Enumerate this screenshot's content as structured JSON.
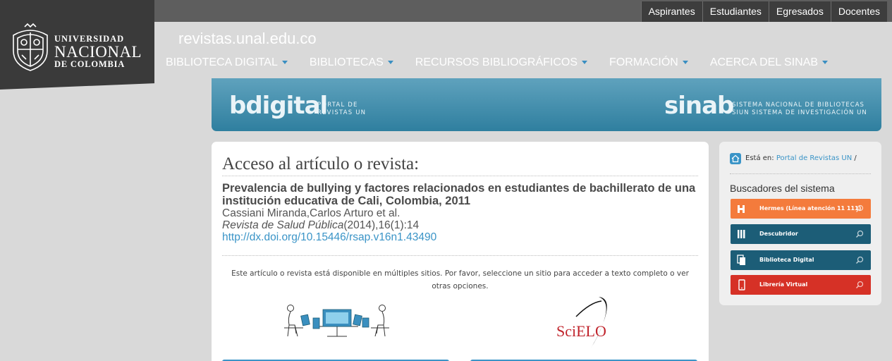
{
  "top_links": [
    "Aspirantes",
    "Estudiantes",
    "Egresados",
    "Docentes"
  ],
  "logo": {
    "line1": "UNIVERSIDAD",
    "line2": "NACIONAL",
    "line3": "DE COLOMBIA"
  },
  "site_url": "revistas.unal.edu.co",
  "nav": [
    "BIBLIOTECA DIGITAL",
    "BIBLIOTECAS",
    "RECURSOS BIBLIOGRÁFICOS",
    "FORMACIÓN",
    "ACERCA DEL SINAB"
  ],
  "banner": {
    "left_logo": "bdigital",
    "left_sub1": "PORTAL DE",
    "left_sub2": "REVISTAS UN",
    "right_logo": "sinab",
    "right_sub1": "SISTEMA NACIONAL DE BIBLIOTECAS",
    "right_sub2": "SIUN SISTEMA DE INVESTIGACIÓN UN"
  },
  "main": {
    "heading": "Acceso al artículo o revista:",
    "article_title": "Prevalencia de bullying y factores relacionados en estudiantes de bachillerato de una institución educativa de Cali, Colombia, 2011",
    "authors": "Cassiani Miranda,Carlos Arturo et al.",
    "journal": "Revista de Salud Pública",
    "citation": "(2014),16(1):14",
    "doi": "http://dx.doi.org/10.15446/rsap.v16n1.43490",
    "notice": "Este artículo o revista está disponible en múltiples sitios. Por favor, seleccione un sitio para acceder a texto completo o ver otras opciones.",
    "scielo_logo": "SciELO"
  },
  "sidebar": {
    "breadcrumb_prefix": "Está en:",
    "breadcrumb_link": "Portal de Revistas UN",
    "breadcrumb_sep": "/",
    "heading": "Buscadores del sistema",
    "buttons": [
      {
        "label": "Hermes (Línea atención 11 111)",
        "color": "#f47b3c"
      },
      {
        "label": "Descubridor",
        "color": "#1c5d77"
      },
      {
        "label": "Biblioteca Digital",
        "color": "#1c5d77"
      },
      {
        "label": "Librería Virtual",
        "color": "#d63126"
      }
    ]
  }
}
